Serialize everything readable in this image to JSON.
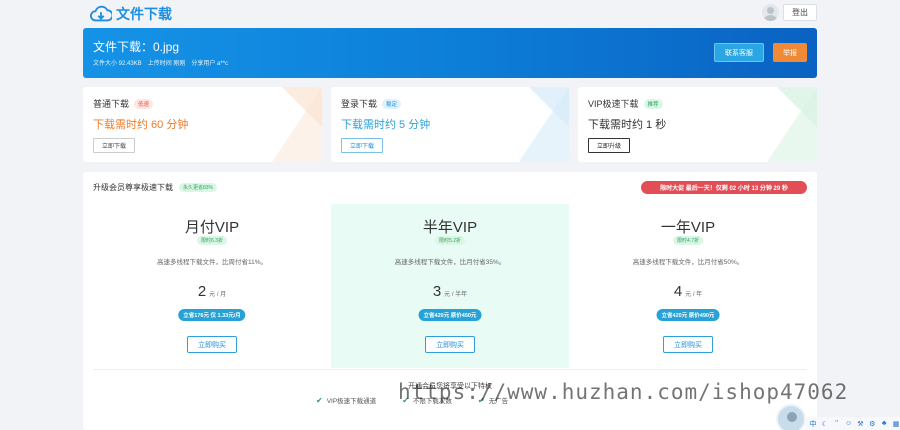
{
  "header": {
    "logo_text": "文件下载",
    "logout_label": "登出"
  },
  "banner": {
    "title": "文件下载：0.jpg",
    "size": "文件大小 92.43KB",
    "uploaded": "上传时间 刚刚",
    "sharer": "分享用户 a**c",
    "service_label": "联系客服",
    "report_label": "举报"
  },
  "download_options": [
    {
      "name": "普通下载",
      "tag": "低速",
      "speed": "下载需时约 60 分钟",
      "button": "立即下载",
      "color": "#ee7a2a"
    },
    {
      "name": "登录下载",
      "tag": "稳定",
      "speed": "下载需时约 5 分钟",
      "button": "立即下载",
      "color": "#2ba0d8"
    },
    {
      "name": "VIP极速下载",
      "tag": "推荐",
      "speed": "下载需时约 1 秒",
      "button": "立即升级",
      "color": "#333333"
    }
  ],
  "vip": {
    "title": "升级会员尊享极速下载",
    "badge": "永久更省83%",
    "countdown": "限时大促 最后一天！仅剩 02 小时 13 分钟 29 秒",
    "plans": [
      {
        "name": "月付VIP",
        "discount": "限时6.3折",
        "desc": "高速多线程下载文件，比周付省11%。",
        "price": "2",
        "unit": "元 / 月",
        "save": "立省176元 仅 1.33元/月",
        "buy": "立即购买"
      },
      {
        "name": "半年VIP",
        "discount": "限时5.2折",
        "desc": "高速多线程下载文件，比月付省35%。",
        "price": "3",
        "unit": "元 / 半年",
        "save": "立省420元 原价450元",
        "buy": "立即购买"
      },
      {
        "name": "一年VIP",
        "discount": "限时4.7折",
        "desc": "高速多线程下载文件，比月付省50%。",
        "price": "4",
        "unit": "元 / 年",
        "save": "立省420元 原价490元",
        "buy": "立即购买"
      }
    ],
    "privileges_title": "开通会员您将享受以下特权",
    "privileges": [
      "VIP极速下载通道",
      "不限下载次数",
      "无广告"
    ]
  },
  "watermark": "https://www.huzhan.com/ishop47062",
  "ime": {
    "lang": "中"
  }
}
